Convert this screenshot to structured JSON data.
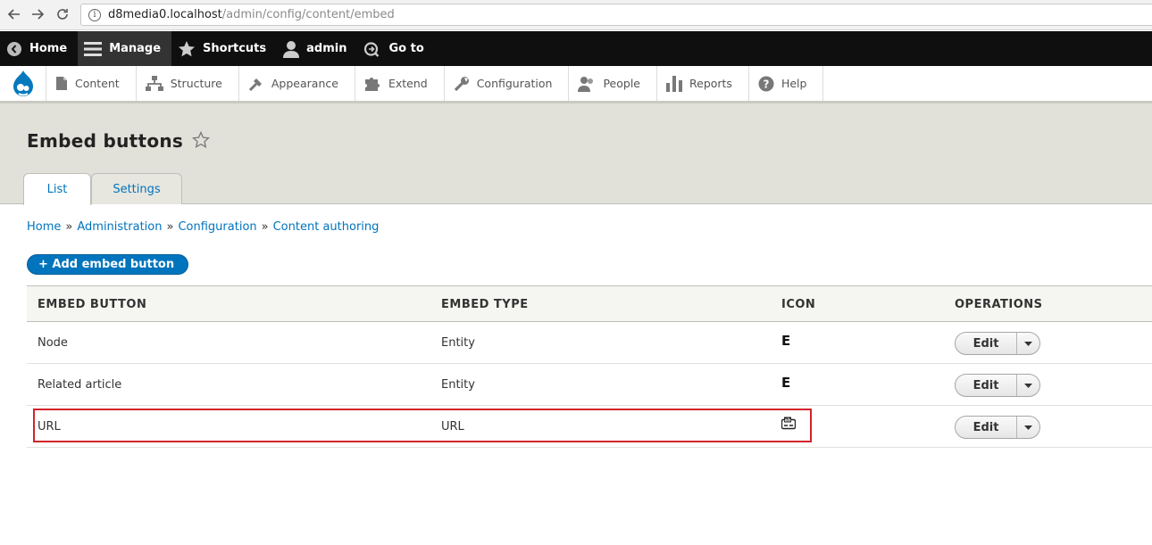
{
  "browser": {
    "url_host": "d8media0.localhost",
    "url_path": "/admin/config/content/embed"
  },
  "toolbar": {
    "items": [
      {
        "label": "Home"
      },
      {
        "label": "Manage"
      },
      {
        "label": "Shortcuts"
      },
      {
        "label": "admin"
      },
      {
        "label": "Go to"
      }
    ]
  },
  "tray": {
    "items": [
      {
        "label": "Content"
      },
      {
        "label": "Structure"
      },
      {
        "label": "Appearance"
      },
      {
        "label": "Extend"
      },
      {
        "label": "Configuration"
      },
      {
        "label": "People"
      },
      {
        "label": "Reports"
      },
      {
        "label": "Help"
      }
    ]
  },
  "page": {
    "title": "Embed buttons",
    "tabs": [
      {
        "label": "List"
      },
      {
        "label": "Settings"
      }
    ]
  },
  "breadcrumb": {
    "items": [
      "Home",
      "Administration",
      "Configuration",
      "Content authoring"
    ],
    "separator": "»"
  },
  "actions": {
    "add_label": "+ Add embed button"
  },
  "table": {
    "headers": [
      "EMBED BUTTON",
      "EMBED TYPE",
      "ICON",
      "OPERATIONS"
    ],
    "rows": [
      {
        "name": "Node",
        "type": "Entity",
        "icon": "E",
        "op": "Edit"
      },
      {
        "name": "Related article",
        "type": "Entity",
        "icon": "E",
        "op": "Edit"
      },
      {
        "name": "URL",
        "type": "URL",
        "icon": "url-embed-icon",
        "op": "Edit"
      }
    ]
  },
  "colors": {
    "link": "#0074bd",
    "toolbar_bg": "#0f0f0f",
    "highlight": "#d2232a"
  }
}
